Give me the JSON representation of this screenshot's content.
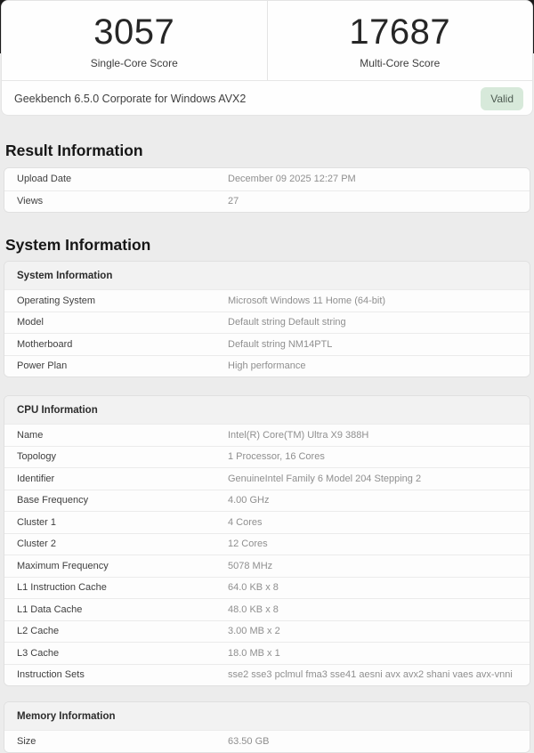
{
  "scores": {
    "single_core": {
      "value": "3057",
      "label": "Single-Core Score"
    },
    "multi_core": {
      "value": "17687",
      "label": "Multi-Core Score"
    }
  },
  "benchmark": {
    "title": "Geekbench 6.5.0 Corporate for Windows AVX2",
    "badge": "Valid"
  },
  "result_information": {
    "heading": "Result Information",
    "rows": [
      {
        "label": "Upload Date",
        "value": "December 09 2025 12:27 PM"
      },
      {
        "label": "Views",
        "value": "27"
      }
    ]
  },
  "system_information": {
    "heading": "System Information",
    "tables": [
      {
        "header": "System Information",
        "rows": [
          {
            "label": "Operating System",
            "value": "Microsoft Windows 11 Home (64-bit)"
          },
          {
            "label": "Model",
            "value": "Default string Default string"
          },
          {
            "label": "Motherboard",
            "value": "Default string NM14PTL"
          },
          {
            "label": "Power Plan",
            "value": "High performance"
          }
        ]
      },
      {
        "header": "CPU Information",
        "rows": [
          {
            "label": "Name",
            "value": "Intel(R) Core(TM) Ultra X9 388H"
          },
          {
            "label": "Topology",
            "value": "1 Processor, 16 Cores"
          },
          {
            "label": "Identifier",
            "value": "GenuineIntel Family 6 Model 204 Stepping 2"
          },
          {
            "label": "Base Frequency",
            "value": "4.00 GHz"
          },
          {
            "label": "Cluster 1",
            "value": "4 Cores"
          },
          {
            "label": "Cluster 2",
            "value": "12 Cores"
          },
          {
            "label": "Maximum Frequency",
            "value": "5078 MHz"
          },
          {
            "label": "L1 Instruction Cache",
            "value": "64.0 KB x 8"
          },
          {
            "label": "L1 Data Cache",
            "value": "48.0 KB x 8"
          },
          {
            "label": "L2 Cache",
            "value": "3.00 MB x 2"
          },
          {
            "label": "L3 Cache",
            "value": "18.0 MB x 1"
          },
          {
            "label": "Instruction Sets",
            "value": "sse2 sse3 pclmul fma3 sse41 aesni avx avx2 shani vaes avx-vnni"
          }
        ]
      },
      {
        "header": "Memory Information",
        "rows": [
          {
            "label": "Size",
            "value": "63.50 GB"
          }
        ]
      }
    ]
  },
  "colors": {
    "valid_badge_bg": "#d7e9da",
    "valid_badge_text": "#4d5b51",
    "page_bg": "#ececec",
    "top_backdrop": "#1a1a1a"
  }
}
